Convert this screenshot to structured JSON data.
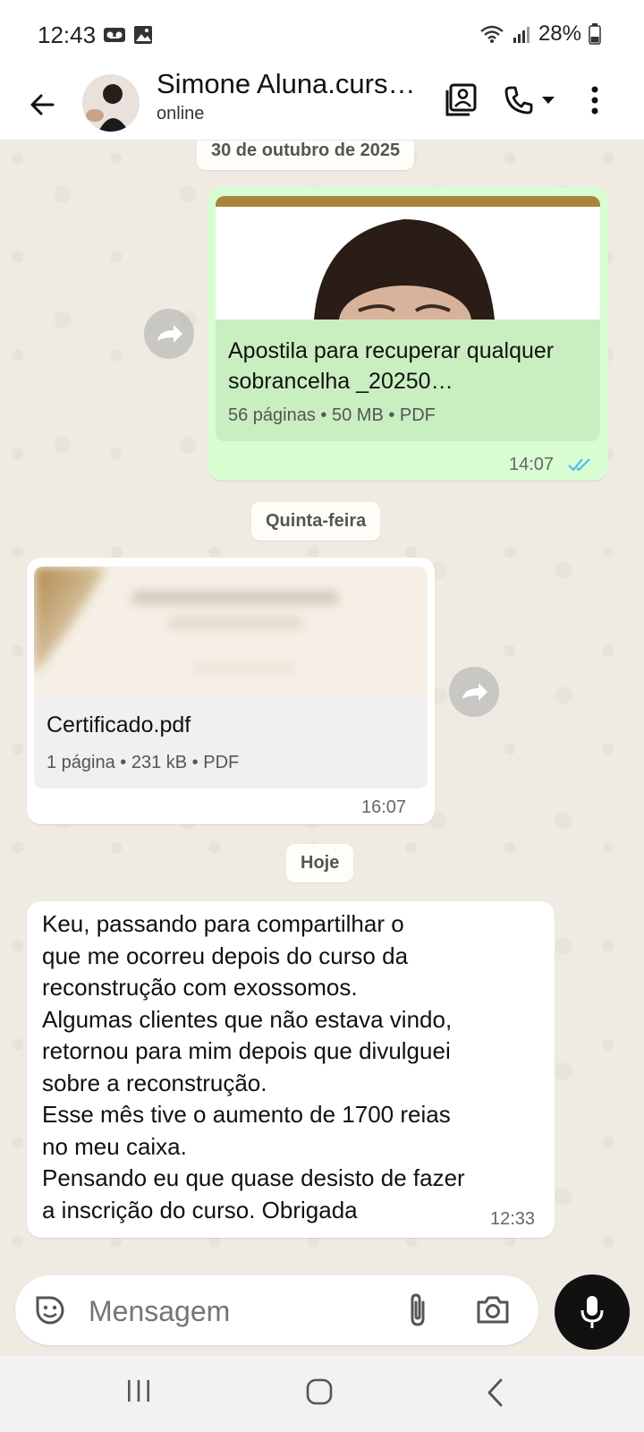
{
  "status_bar": {
    "time": "12:43",
    "battery": "28%"
  },
  "header": {
    "contact_name": "Simone Aluna.curs…",
    "contact_status": "online",
    "icons": [
      "back-arrow-icon",
      "contact-card-icon",
      "phone-icon",
      "dropdown-icon",
      "more-vert-icon"
    ]
  },
  "chat": {
    "date_1": "30 de outubro de 2025",
    "message_1": {
      "file_name": "Apostila para recuperar qualquer sobrancelha _20250…",
      "meta": "56 páginas • 50 MB • PDF",
      "time": "14:07",
      "status": "read"
    },
    "date_2": "Quinta-feira",
    "message_2": {
      "file_name": "Certificado.pdf",
      "meta": "1 página • 231 kB • PDF",
      "time": "16:07"
    },
    "date_3": "Hoje",
    "message_3": {
      "text": "Keu, passando para compartilhar o\nque me ocorreu depois do curso da\nreconstrução com exossomos.\nAlgumas clientes que não estava vindo,\nretornou para mim depois que divulguei\nsobre a reconstrução.\nEsse mês tive o aumento de 1700 reias\nno meu caixa.\nPensando eu que quase desisto de fazer\na inscrição do curso. Obrigada",
      "time": "12:33"
    }
  },
  "input": {
    "placeholder": "Mensagem"
  },
  "colors": {
    "outgoing_bubble": "#d9fdd3",
    "incoming_bubble": "#ffffff",
    "chat_background": "#efeae2",
    "read_ticks": "#53bdeb"
  }
}
